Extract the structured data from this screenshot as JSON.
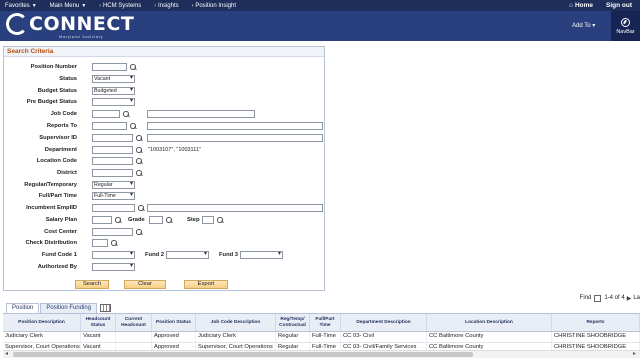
{
  "topnav": {
    "favorites": "Favorites",
    "main_menu": "Main Menu",
    "crumb1": "HCM Systems",
    "crumb2": "Insights",
    "crumb3": "Position Insight",
    "home": "Home",
    "signout": "Sign out"
  },
  "banner": {
    "logo": "CONNECT",
    "logo_sub": "Maryland Judiciary",
    "add_to": "Add To",
    "navbar": "NavBar"
  },
  "search": {
    "title": "Search Criteria",
    "labels": {
      "position_number": "Position Number",
      "status": "Status",
      "budget_status": "Budget Status",
      "pre_budget_status": "Pre Budget Status",
      "job_code": "Job Code",
      "reports_to": "Reports To",
      "supervisor_id": "Supervisor ID",
      "department": "Department",
      "location_code": "Location Code",
      "district": "District",
      "regular_temporary": "Regular/Temporary",
      "full_part_time": "Full/Part Time",
      "incumbent_emplid": "Incumbent EmplID",
      "salary_plan": "Salary Plan",
      "grade": "Grade",
      "step": "Step",
      "cost_center": "Cost Center",
      "check_distribution": "Check Distribution",
      "fund_code_1": "Fund Code 1",
      "fund_2": "Fund 2",
      "fund_3": "Fund 3",
      "authorized_by": "Authorized By"
    },
    "values": {
      "status": "Vacant",
      "budget_status": "Budgeted",
      "department_hint": "\"1003107\", \"1003111\"",
      "regular_temporary": "Regular",
      "full_part_time": "Full-Time"
    },
    "buttons": {
      "search": "Search",
      "clear": "Clear",
      "export": "Export"
    }
  },
  "tabs": {
    "position": "Position",
    "position_funding": "Position Funding"
  },
  "grid_nav": {
    "find": "Find",
    "range": "1-4 of 4",
    "last": "La"
  },
  "table": {
    "headers": [
      "Position Description",
      "Headcount Status",
      "Current Headcount",
      "Position Status",
      "Job Code Description",
      "Reg/Temp/ Contractual",
      "Full/Part Time",
      "Department Description",
      "Location Description",
      "Reports"
    ],
    "rows": [
      [
        "Judiciary Clerk",
        "Vacant",
        "",
        "Approved",
        "Judiciary Clerk",
        "Regular",
        "Full-Time",
        "CC 03- Civil",
        "CC Baltimore County",
        "CHRISTINE SHOOBRIDGE"
      ],
      [
        "Supervisor, Court Operations",
        "Vacant",
        "",
        "Approved",
        "Supervisor, Court Operations",
        "Regular",
        "Full-Time",
        "CC 03- Civil/Family Services",
        "CC Baltimore County",
        "CHRISTINE SHOOBRIDGE"
      ]
    ]
  },
  "colors": {
    "nav": "#1f2d5a",
    "banner": "#2a3f7e",
    "section_title": "#b34f12",
    "button": "#f7cf84"
  }
}
